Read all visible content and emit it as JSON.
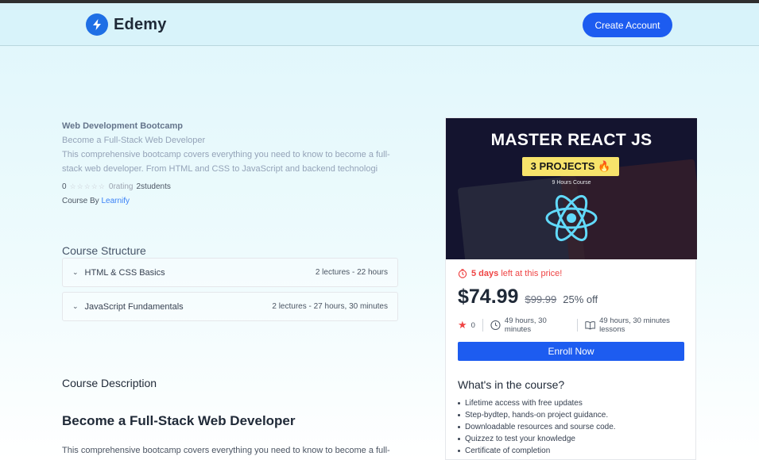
{
  "app": {
    "brand": "Edemy",
    "cta": "Create Account"
  },
  "course": {
    "title": "Web Development Bootcamp",
    "subtitle": "Become a Full-Stack Web Developer",
    "short_desc": "This comprehensive bootcamp covers everything you need to know to become a full-stack web developer. From HTML and CSS to JavaScript and backend technologi",
    "rating": "0",
    "rating_label": "0rating",
    "students": "2students",
    "by_prefix": "Course By",
    "educator": "Learnify"
  },
  "structure": {
    "heading": "Course Structure",
    "chapters": [
      {
        "name": "HTML & CSS Basics",
        "meta": "2 lectures - 22 hours"
      },
      {
        "name": "JavaScript Fundamentals",
        "meta": "2 lectures - 27 hours, 30 minutes"
      }
    ]
  },
  "description": {
    "heading": "Course Description",
    "big_heading": "Become a Full-Stack Web Developer",
    "text": "This comprehensive bootcamp covers everything you need to know to become a full-"
  },
  "card": {
    "thumb_title": "MASTER REACT JS",
    "thumb_badge": "3 PROJECTS 🔥",
    "thumb_small": "9 Hours Course",
    "days": "5 days",
    "deadline_rest": "left at this price!",
    "price": "$74.99",
    "old_price": "$99.99",
    "discount": "25% off",
    "rating": "0",
    "duration": "49 hours, 30 minutes",
    "lessons": "49 hours, 30 minutes lessons",
    "enroll": "Enroll Now",
    "whats_heading": "What's in the course?",
    "features": [
      "Lifetime access with free updates",
      "Step-bydtep, hands-on project guidance.",
      "Downloadable resources and sourse code.",
      "Quizzez to test your knowledge",
      "Certificate of completion"
    ]
  },
  "colors": {
    "accent": "#1d5cf0",
    "deadline": "#ef4444",
    "bg": "#dff6fb"
  }
}
